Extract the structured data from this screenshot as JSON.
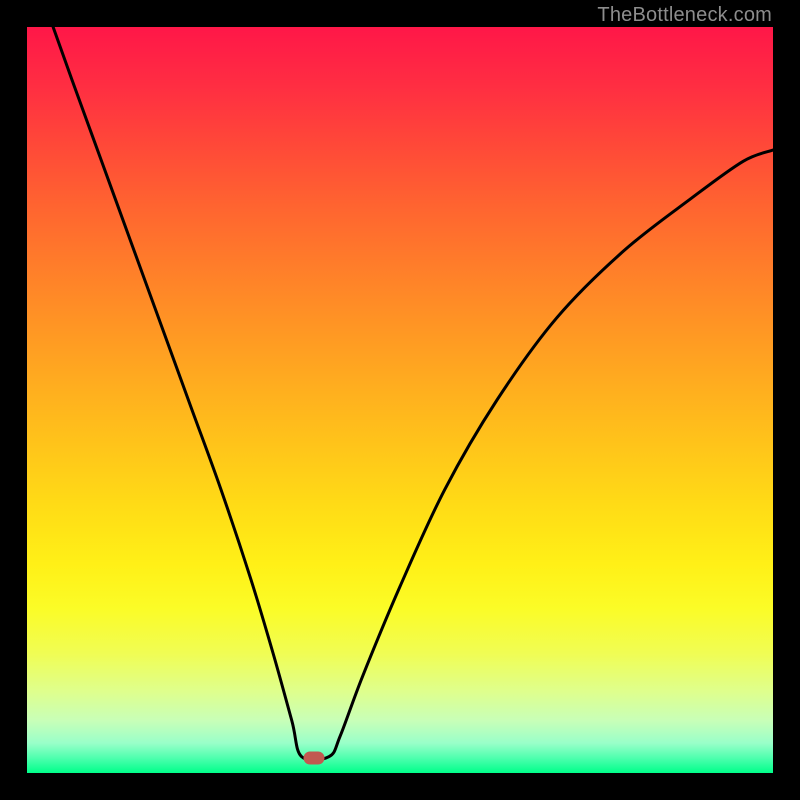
{
  "watermark": "TheBottleneck.com",
  "gradient": {
    "top_color": "#ff1748",
    "bottom_color": "#00ff8a"
  },
  "chart_data": {
    "type": "line",
    "title": "",
    "xlabel": "",
    "ylabel": "",
    "xlim": [
      0,
      100
    ],
    "ylim": [
      0,
      100
    ],
    "marker": {
      "x": 38.5,
      "y": 2
    },
    "curve_left": [
      {
        "x": 3.5,
        "y": 100
      },
      {
        "x": 6,
        "y": 93
      },
      {
        "x": 10,
        "y": 82
      },
      {
        "x": 14,
        "y": 71
      },
      {
        "x": 18,
        "y": 60
      },
      {
        "x": 22,
        "y": 49
      },
      {
        "x": 26,
        "y": 38
      },
      {
        "x": 30,
        "y": 26
      },
      {
        "x": 33,
        "y": 16
      },
      {
        "x": 35.5,
        "y": 7
      },
      {
        "x": 36.8,
        "y": 2.2
      }
    ],
    "curve_flat": [
      {
        "x": 36.8,
        "y": 2.2
      },
      {
        "x": 40.5,
        "y": 2.2
      }
    ],
    "curve_right": [
      {
        "x": 40.5,
        "y": 2.2
      },
      {
        "x": 42,
        "y": 5
      },
      {
        "x": 45,
        "y": 13
      },
      {
        "x": 50,
        "y": 25
      },
      {
        "x": 56,
        "y": 38
      },
      {
        "x": 63,
        "y": 50
      },
      {
        "x": 71,
        "y": 61
      },
      {
        "x": 80,
        "y": 70
      },
      {
        "x": 89,
        "y": 77
      },
      {
        "x": 96,
        "y": 82
      },
      {
        "x": 100,
        "y": 83.5
      }
    ]
  }
}
